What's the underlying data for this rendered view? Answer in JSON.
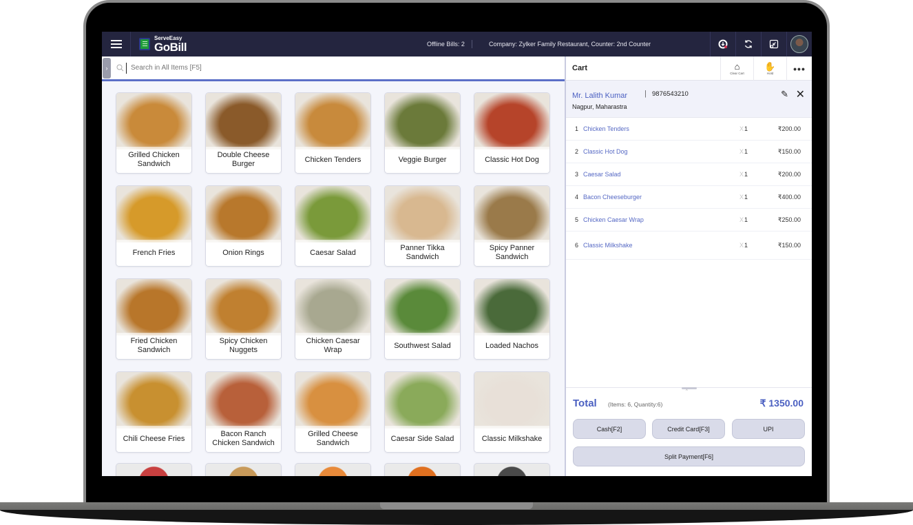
{
  "app": {
    "brand_small": "ServeEasy",
    "brand_big": "GoBill",
    "offline_bills": "Offline Bills: 2",
    "company_info": "Company: Zylker Family Restaurant,  Counter: 2nd Counter",
    "icons": [
      "menu-icon",
      "download-sync-icon",
      "refresh-icon",
      "exit-fullscreen-icon",
      "user-avatar"
    ]
  },
  "search": {
    "placeholder": "Search in All Items [F5]",
    "value": ""
  },
  "items": [
    {
      "name": "Grilled Chicken Sandwich",
      "color": "#c98a3a"
    },
    {
      "name": "Double Cheese Burger",
      "color": "#8a5a2a"
    },
    {
      "name": "Chicken Tenders",
      "color": "#c88a3c"
    },
    {
      "name": "Veggie Burger",
      "color": "#6b7a3a"
    },
    {
      "name": "Classic Hot Dog",
      "color": "#b6442a"
    },
    {
      "name": "French Fries",
      "color": "#d69a2a"
    },
    {
      "name": "Onion Rings",
      "color": "#b8782c"
    },
    {
      "name": "Caesar Salad",
      "color": "#7a9a3a"
    },
    {
      "name": "Panner Tikka Sandwich",
      "color": "#d8b890"
    },
    {
      "name": "Spicy Panner Sandwich",
      "color": "#9a7a4a"
    },
    {
      "name": "Fried Chicken Sandwich",
      "color": "#b8762a"
    },
    {
      "name": "Spicy Chicken Nuggets",
      "color": "#c08030"
    },
    {
      "name": "Chicken Caesar Wrap",
      "color": "#a8a890"
    },
    {
      "name": "Southwest Salad",
      "color": "#5a8a3a"
    },
    {
      "name": "Loaded Nachos",
      "color": "#4a6a3a"
    },
    {
      "name": "Chili Cheese Fries",
      "color": "#c89030"
    },
    {
      "name": "Bacon Ranch Chicken Sandwich",
      "color": "#b8603a"
    },
    {
      "name": "Grilled Cheese Sandwich",
      "color": "#d89040"
    },
    {
      "name": "Caesar Side Salad",
      "color": "#8aaa5a"
    },
    {
      "name": "Classic Milkshake",
      "color": "#e8e0d8"
    }
  ],
  "partial_items_colors": [
    "#c84040",
    "#c89a5a",
    "#e88a3a",
    "#e07020",
    "#4a4a4a"
  ],
  "cart": {
    "title": "Cart",
    "clear_cart_label": "Clear Cart",
    "hold_label": "Hold",
    "more_label": "•••",
    "customer": {
      "name": "Mr. Lalith Kumar",
      "phone": "9876543210",
      "location": "Nagpur, Maharastra"
    },
    "lines": [
      {
        "no": "1",
        "name": "Chicken Tenders",
        "qty": "1",
        "price": "₹200.00"
      },
      {
        "no": "2",
        "name": "Classic Hot Dog",
        "qty": "1",
        "price": "₹150.00"
      },
      {
        "no": "3",
        "name": "Caesar Salad",
        "qty": "1",
        "price": "₹200.00"
      },
      {
        "no": "4",
        "name": "Bacon Cheeseburger",
        "qty": "1",
        "price": "₹400.00"
      },
      {
        "no": "5",
        "name": "Chicken Caesar Wrap",
        "qty": "1",
        "price": "₹250.00"
      },
      {
        "no": "6",
        "name": "Classic Milkshake",
        "qty": "1",
        "price": "₹150.00"
      }
    ],
    "total_label": "Total",
    "total_summary": "(Items: 6, Quantity:6)",
    "total_amount": "₹ 1350.00",
    "buttons": {
      "cash": "Cash[F2]",
      "credit_card": "Credit Card[F3]",
      "upi": "UPI",
      "split": "Split Payment[F6]"
    }
  }
}
